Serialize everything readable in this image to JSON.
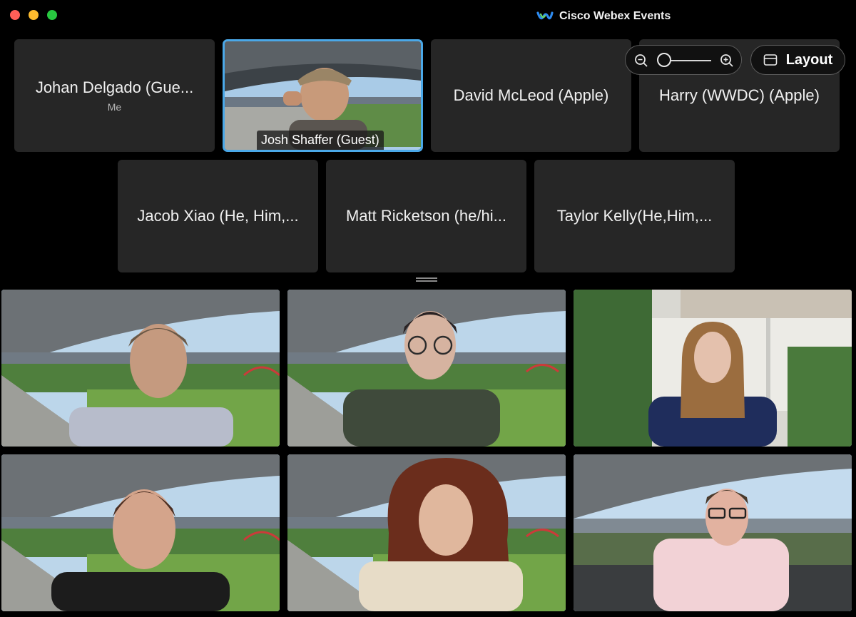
{
  "window": {
    "title": "Cisco Webex Events",
    "traffic_lights": [
      "close",
      "minimize",
      "zoom"
    ]
  },
  "controls": {
    "zoom_out_icon": "zoom-out-icon",
    "zoom_in_icon": "zoom-in-icon",
    "layout_label": "Layout",
    "layout_icon": "layout-icon"
  },
  "participants_top": [
    {
      "name": "Johan Delgado (Gue...",
      "sub": "Me"
    },
    {
      "name": "Josh Shaffer (Guest)",
      "video": true,
      "active_speaker": true
    },
    {
      "name": "David McLeod (Apple)"
    },
    {
      "name": "Harry (WWDC) (Apple)"
    },
    {
      "name": "Jacob Xiao (He, Him,..."
    },
    {
      "name": "Matt Ricketson (he/hi..."
    },
    {
      "name": "Taylor Kelly(He,Him,..."
    }
  ],
  "video_grid": [
    {
      "id": "video-1"
    },
    {
      "id": "video-2"
    },
    {
      "id": "video-3"
    },
    {
      "id": "video-4"
    },
    {
      "id": "video-5"
    },
    {
      "id": "video-6"
    }
  ],
  "colors": {
    "background": "#000000",
    "tile": "#262626",
    "active_border": "#4aa8e8",
    "accent": "#1f6fd9"
  }
}
